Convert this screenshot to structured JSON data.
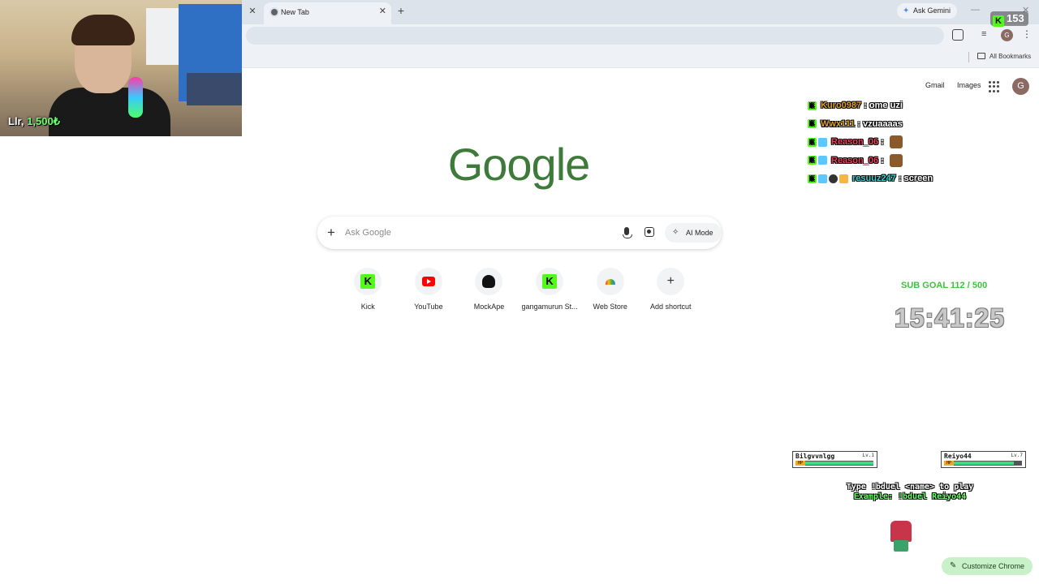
{
  "browser": {
    "tab_title": "New Tab",
    "ask_gemini_label": "Ask Gemini",
    "profile_initial": "G",
    "bookmarks_label": "All Bookmarks"
  },
  "header": {
    "gmail_label": "Gmail",
    "images_label": "Images",
    "account_initial": "G"
  },
  "logo_text": "Google",
  "search": {
    "placeholder": "Ask Google",
    "ai_mode_label": "AI Mode"
  },
  "shortcuts": [
    {
      "label": "Kick",
      "icon": "kick-icon"
    },
    {
      "label": "YouTube",
      "icon": "youtube-icon"
    },
    {
      "label": "MockApe",
      "icon": "mockape-icon"
    },
    {
      "label": "gangamurun St...",
      "icon": "kick-icon"
    },
    {
      "label": "Web Store",
      "icon": "web-store-icon"
    },
    {
      "label": "Add shortcut",
      "icon": "plus-icon"
    }
  ],
  "customize_label": "Customize Chrome",
  "stream": {
    "cam_caption_name": "Llr,",
    "cam_caption_amount": "1,500₺",
    "viewer_count": "153",
    "chat": [
      {
        "user": "Kuro0987",
        "message": "ome uzi",
        "color": "#e0a020"
      },
      {
        "user": "Wwx111",
        "message": "vzuaaaas",
        "color": "#e0a020"
      },
      {
        "user": "Reason_06",
        "message": "",
        "color": "#e8405a"
      },
      {
        "user": "Reason_06",
        "message": "",
        "color": "#e8405a"
      },
      {
        "user": "resuuz247",
        "message": "screen",
        "color": "#3ad0d0"
      }
    ],
    "sub_goal": "SUB GOAL 112 / 500",
    "clock": "15:41:25",
    "duel": {
      "player1": {
        "name": "Bilgvvnlgg",
        "level": "Lv.1",
        "hp_fraction": 1.0
      },
      "player2": {
        "name": "Reiyo44",
        "level": "Lv.7",
        "hp_fraction": 0.88
      },
      "hp_label": "HP",
      "instruction": "Type !bduel <name> to play",
      "example": "Example: !bduel Reiyo44"
    }
  },
  "colors": {
    "kick_green": "#53fc18",
    "google_logo": "#3e7a3a",
    "customize_bg": "#c9f1c9"
  }
}
